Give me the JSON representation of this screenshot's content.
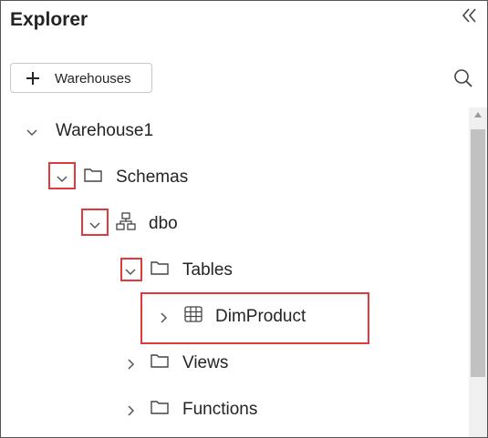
{
  "panel": {
    "title": "Explorer"
  },
  "toolbar": {
    "add_label": "Warehouses"
  },
  "tree": {
    "root": "Warehouse1",
    "schemas": "Schemas",
    "dbo": "dbo",
    "tables": "Tables",
    "dimproduct": "DimProduct",
    "views": "Views",
    "functions": "Functions"
  },
  "colors": {
    "highlight": "#e0393e",
    "text": "#242424"
  },
  "icons": {
    "collapse": "double-chevron-left-icon",
    "add": "plus-icon",
    "search": "search-icon",
    "folder": "folder-icon",
    "schema": "schema-icon",
    "table": "table-grid-icon"
  }
}
